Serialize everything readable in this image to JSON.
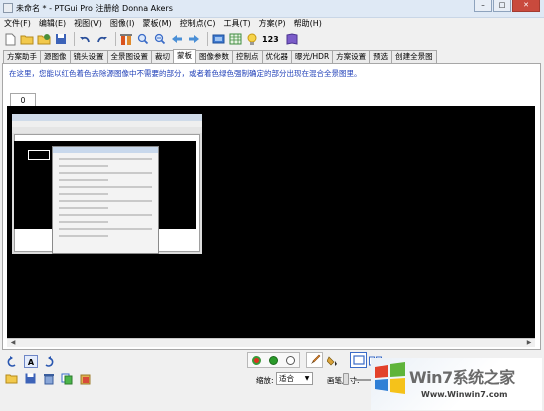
{
  "window": {
    "title": "未命名 * - PTGui Pro 注册给 Donna Akers",
    "controls": {
      "minimize": "–",
      "maximize": "□",
      "close": "✕"
    }
  },
  "menu": [
    "文件(F)",
    "编辑(E)",
    "视图(V)",
    "图像(I)",
    "蒙板(M)",
    "控制点(C)",
    "工具(T)",
    "方案(P)",
    "帮助(H)"
  ],
  "toolbar": {
    "icons": [
      "new-file-icon",
      "open-folder-icon",
      "open-recent-icon",
      "save-icon",
      "undo-icon",
      "redo-icon",
      "tools-icon",
      "zoom-in-icon",
      "zoom-out-icon",
      "back-arrow-icon",
      "forward-arrow-icon",
      "panorama-editor-icon",
      "table-icon",
      "bulb-icon",
      "help-book-icon"
    ],
    "number_label": "123"
  },
  "tabs": [
    {
      "label": "方案助手",
      "active": false
    },
    {
      "label": "源图像",
      "active": false
    },
    {
      "label": "镜头设置",
      "active": false
    },
    {
      "label": "全景图设置",
      "active": false
    },
    {
      "label": "裁切",
      "active": false
    },
    {
      "label": "蒙板",
      "active": true
    },
    {
      "label": "图像参数",
      "active": false
    },
    {
      "label": "控制点",
      "active": false
    },
    {
      "label": "优化器",
      "active": false
    },
    {
      "label": "曝光/HDR",
      "active": false
    },
    {
      "label": "方案设置",
      "active": false
    },
    {
      "label": "预选",
      "active": false
    },
    {
      "label": "创建全景图",
      "active": false
    }
  ],
  "mask_panel": {
    "instruction": "在这里，您能以红色着色去除源图像中不需要的部分，或者着色绿色强制确定的部分出现在混合全景图里。",
    "image_tab_label": "0"
  },
  "bottom_bar": {
    "zoom_label": "缩放:",
    "zoom_value": "适合",
    "brush_label": "画笔尺寸:",
    "a_button_label": "A"
  },
  "colors": {
    "instruction_text": "#1f3fb8",
    "canvas_bg": "#000000",
    "paint_red": "#e03020",
    "paint_green": "#2a9a2a"
  },
  "watermark": {
    "main": "Win7系统之家",
    "url": "Www.Winwin7.com"
  }
}
